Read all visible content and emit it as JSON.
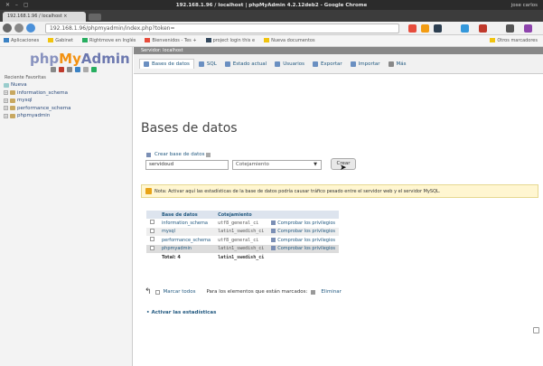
{
  "window": {
    "title": "192.168.1.96 / localhost | phpMyAdmin 4.2.12deb2 - Google Chrome",
    "user": "jose carlos"
  },
  "browser": {
    "tab_label": "192.168.1.96 / localhost ×",
    "url": "192.168.1.96/phpmyadmin/index.php?token=",
    "bookmarks": [
      "Aplicaciones",
      "Gabinet",
      "Rightmove en Inglés",
      "Bienvenidos - Tes +",
      "project login this e",
      "Nueva documentos",
      "Otros marcadores"
    ]
  },
  "navigation": {
    "logo": {
      "php": "php",
      "my": "My",
      "admin": "Admin"
    },
    "tabs_label": "Reciente  Favoritas",
    "tree": [
      {
        "label": "Nueva"
      },
      {
        "label": "information_schema"
      },
      {
        "label": "mysql"
      },
      {
        "label": "performance_schema"
      },
      {
        "label": "phpmyadmin"
      }
    ]
  },
  "server_bar": {
    "label": "Servidor: localhost"
  },
  "menubar": {
    "items": [
      {
        "label": "Bases de datos",
        "icon": "database-icon"
      },
      {
        "label": "SQL",
        "icon": "sql-icon"
      },
      {
        "label": "Estado actual",
        "icon": "status-icon"
      },
      {
        "label": "Usuarios",
        "icon": "users-icon"
      },
      {
        "label": "Exportar",
        "icon": "export-icon"
      },
      {
        "label": "Importar",
        "icon": "import-icon"
      },
      {
        "label": "Más",
        "icon": "more-icon"
      }
    ]
  },
  "main": {
    "heading": "Bases de datos",
    "create_label": "Crear base de datos",
    "db_name_value": "servidoud",
    "collation_placeholder": "Cotejamiento",
    "create_button": "Crear",
    "notice": "Nota: Activar aquí las estadísticas de la base de datos podría causar tráfico pesado entre el servidor web y el servidor MySQL.",
    "table": {
      "headers": [
        "Base de datos",
        "Cotejamiento"
      ],
      "rows": [
        {
          "name": "information_schema",
          "collation": "utf8_general_ci",
          "privs": "Comprobar los privilegios"
        },
        {
          "name": "mysql",
          "collation": "latin1_swedish_ci",
          "privs": "Comprobar los privilegios"
        },
        {
          "name": "performance_schema",
          "collation": "utf8_general_ci",
          "privs": "Comprobar los privilegios"
        },
        {
          "name": "phpmyadmin",
          "collation": "latin1_swedish_ci",
          "privs": "Comprobar los privilegios"
        }
      ],
      "total_label": "Total: 4",
      "total_collation": "latin1_swedish_ci"
    },
    "bulk": {
      "check_all": "Marcar todos",
      "for_selected": "Para los elementos que están marcados:",
      "drop": "Eliminar"
    },
    "enable_stats": "Activar las estadísticas"
  },
  "colors": {
    "accent_link": "#235a81",
    "logo_orange": "#f29111",
    "notice_bg": "#fff6d1"
  }
}
